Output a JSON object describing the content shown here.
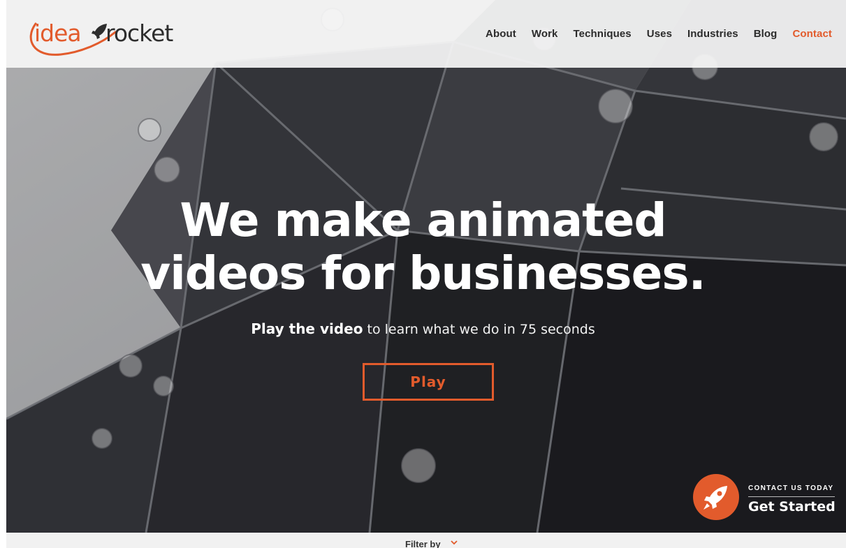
{
  "brand": {
    "logo_part1": "idea",
    "logo_part2": "rocket",
    "accent_color": "#e25b2c"
  },
  "nav": {
    "items": [
      {
        "label": "About",
        "active": false
      },
      {
        "label": "Work",
        "active": false
      },
      {
        "label": "Techniques",
        "active": false
      },
      {
        "label": "Uses",
        "active": false
      },
      {
        "label": "Industries",
        "active": false
      },
      {
        "label": "Blog",
        "active": false
      },
      {
        "label": "Contact",
        "active": true
      }
    ]
  },
  "hero": {
    "headline_line1": "We make animated",
    "headline_line2": "videos for businesses.",
    "sub_strong": "Play the video",
    "sub_rest": " to learn what we do in 75 seconds",
    "play_label": "Play"
  },
  "cta": {
    "small_label": "CONTACT US TODAY",
    "big_label": "Get Started",
    "icon": "rocket-icon"
  },
  "filter": {
    "label": "Filter by",
    "icon": "chevron-down-icon"
  }
}
